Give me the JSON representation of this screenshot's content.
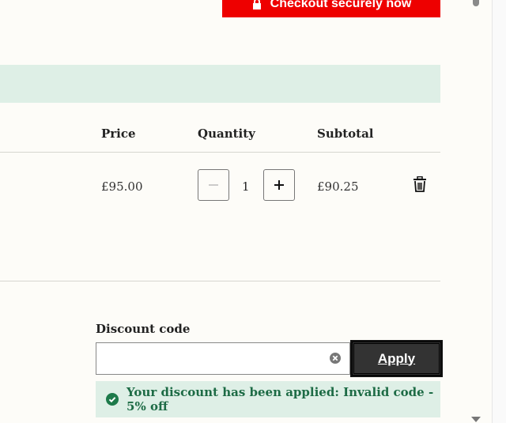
{
  "checkout": {
    "label": "Checkout securely now"
  },
  "table": {
    "headers": {
      "price": "Price",
      "quantity": "Quantity",
      "subtotal": "Subtotal"
    },
    "row": {
      "price": "£95.00",
      "quantity": "1",
      "subtotal": "£90.25"
    }
  },
  "discount": {
    "label": "Discount code",
    "value": "",
    "apply_label": "Apply",
    "message": "Your discount has been applied: Invalid code - 5% off"
  },
  "colors": {
    "checkout": "#ee0000",
    "banner": "#deefe6",
    "success_text": "#1d6b45",
    "success_icon": "#1d7a4a"
  },
  "icons": {
    "checkout": "lock-icon",
    "remove": "trash-icon",
    "clear": "clear-circle-icon",
    "success": "check-circle-icon",
    "scroll_down": "scroll-down-arrow-icon"
  }
}
